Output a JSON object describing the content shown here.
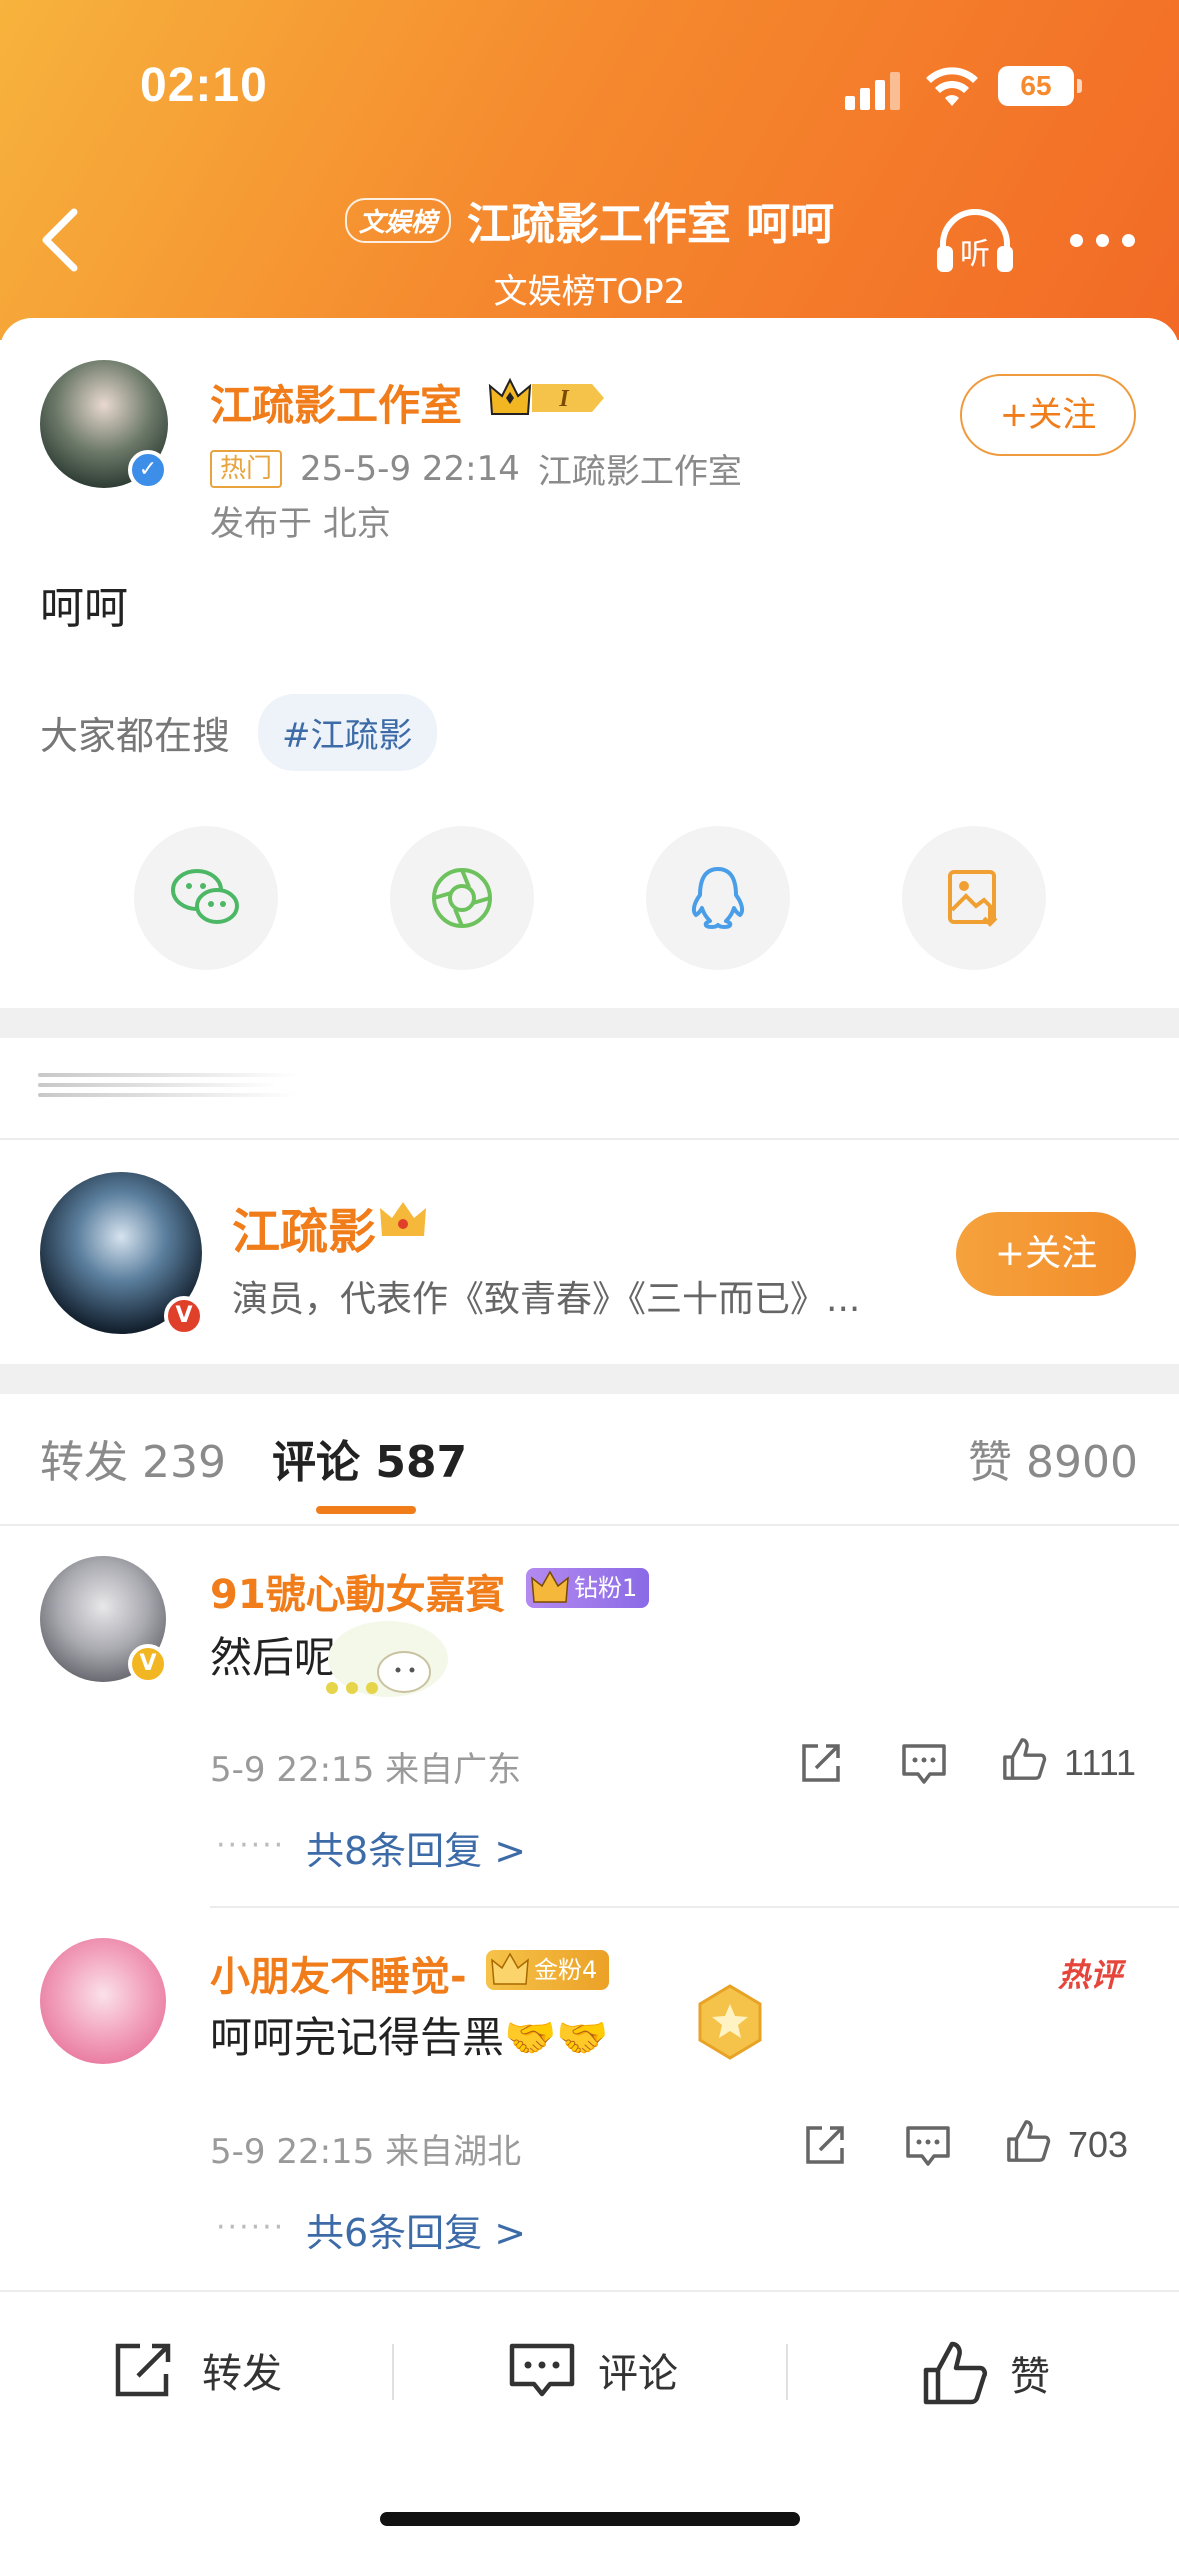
{
  "status_bar": {
    "time": "02:10",
    "battery": "65"
  },
  "nav": {
    "tag": "文娱榜",
    "title": "江疏影工作室 呵呵",
    "subtitle": "文娱榜TOP2",
    "listen_label": "听"
  },
  "post": {
    "author": "江疏影工作室",
    "badge_level": "I",
    "hot_tag": "热门",
    "datetime": "25-5-9 22:14",
    "source": "江疏影工作室",
    "location": "发布于 北京",
    "text": "呵呵",
    "follow_label": "+关注",
    "search_label": "大家都在搜",
    "search_chip": "#江疏影"
  },
  "share_icons": [
    "wechat-icon",
    "moments-icon",
    "qq-icon",
    "save-image-icon"
  ],
  "colors": {
    "accent": "#f07c1a",
    "link": "#3d6ba8",
    "header_start": "#f7b33d",
    "header_end": "#f26a26"
  },
  "star_card": {
    "name": "江疏影",
    "description": "演员，代表作《致青春》《三十而已》...",
    "follow_label": "+关注"
  },
  "tabs": {
    "repost_label": "转发",
    "repost_count": "239",
    "comment_label": "评论",
    "comment_count": "587",
    "like_label": "赞",
    "like_count": "8900"
  },
  "comments": [
    {
      "name": "91號心動女嘉賓",
      "fan_badge": "钻粉1",
      "text": "然后呢",
      "time": "5-9 22:15",
      "location": "来自广东",
      "likes": "1111",
      "replies": "共8条回复 >",
      "hot_label": ""
    },
    {
      "name": "小朋友不睡觉-",
      "fan_badge": "金粉4",
      "text": "呵呵完记得告黑🤝🤝",
      "time": "5-9 22:15",
      "location": "来自湖北",
      "likes": "703",
      "replies": "共6条回复 >",
      "hot_label": "热评"
    }
  ],
  "bottom_bar": {
    "repost": "转发",
    "comment": "评论",
    "like": "赞"
  }
}
